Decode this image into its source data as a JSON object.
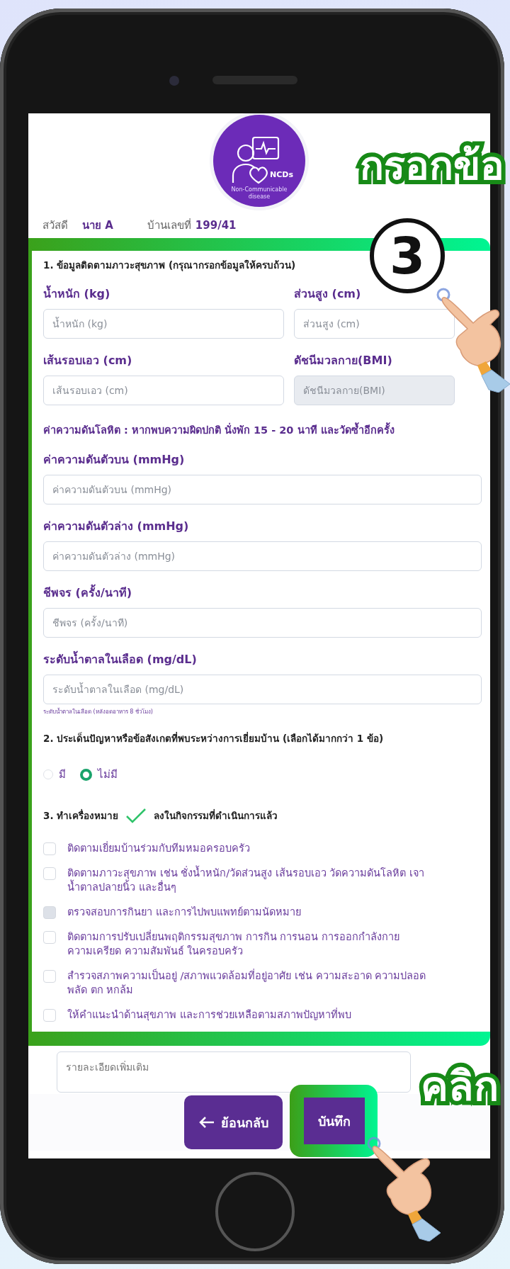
{
  "logo": {
    "title": "NCDs",
    "subtitle": "Non-Communicable disease"
  },
  "greeting": {
    "label": "สวัสดี",
    "name": "นาย A",
    "house_label": "บ้านเลขที่",
    "house_number": "199/41"
  },
  "section_1": {
    "title": "1. ข้อมูลติดตามภาวะสุขภาพ (กรุณากรอกข้อมูลให้ครบถ้วน)",
    "items": [
      {
        "kind": "pair",
        "fields": [
          {
            "label": "น้ำหนัก (kg)",
            "placeholder": "น้ำหนัก (kg)",
            "disabled": false
          },
          {
            "label": "ส่วนสูง (cm)",
            "placeholder": "ส่วนสูง (cm)",
            "disabled": false
          }
        ]
      },
      {
        "kind": "pair",
        "fields": [
          {
            "label": "เส้นรอบเอว (cm)",
            "placeholder": "เส้นรอบเอว (cm)",
            "disabled": false
          },
          {
            "label": "ดัชนีมวลกาย(BMI)",
            "placeholder": "ดัชนีมวลกาย(BMI)",
            "disabled": true
          }
        ]
      },
      {
        "kind": "note",
        "text": "ค่าความดันโลหิต : หากพบความผิดปกติ นั่งพัก 15 - 20 นาที และวัดซ้ำอีกครั้ง"
      },
      {
        "kind": "field",
        "label": "ค่าความดันตัวบน (mmHg)",
        "placeholder": "ค่าความดันตัวบน (mmHg)",
        "disabled": false
      },
      {
        "kind": "field",
        "label": "ค่าความดันตัวล่าง (mmHg)",
        "placeholder": "ค่าความดันตัวล่าง (mmHg)",
        "disabled": false
      },
      {
        "kind": "field",
        "label": "ชีพจร (ครั้ง/นาที)",
        "placeholder": "ชีพจร (ครั้ง/นาที)",
        "disabled": false
      },
      {
        "kind": "field",
        "label": "ระดับน้ำตาลในเลือด (mg/dL)",
        "placeholder": "ระดับน้ำตาลในเลือด (mg/dL)",
        "disabled": false
      },
      {
        "kind": "hint",
        "text": "ระดับน้ำตาลในเลือด (หลังอดอาหาร 8 ชั่วโมง)"
      }
    ]
  },
  "section_2": {
    "title": "2. ประเด็นปัญหาหรือข้อสังเกตที่พบระหว่างการเยี่ยมบ้าน (เลือกได้มากกว่า 1 ข้อ)",
    "options": [
      {
        "label": "มี",
        "selected": false
      },
      {
        "label": "ไม่มี",
        "selected": true
      }
    ]
  },
  "section_3": {
    "title_start": "3. ทำเครื่องหมาย",
    "title_end": "ลงในกิจกรรมที่ดำเนินการแล้ว",
    "items": [
      {
        "text": "ติดตามเยี่ยมบ้านร่วมกับทีมหมอครอบครัว",
        "checked": false,
        "disabled": false
      },
      {
        "text": "ติดตามภาวะสุขภาพ เช่น ชั่งน้ำหนัก/วัดส่วนสูง เส้นรอบเอว วัดความดันโลหิต เจา\nน้ำตาลปลายนิ้ว และอื่นๆ",
        "checked": false,
        "disabled": false
      },
      {
        "text": "ตรวจสอบการกินยา และการไปพบแพทย์ตามนัดหมาย",
        "checked": false,
        "disabled": true
      },
      {
        "text": "ติดตามการปรับเปลี่ยนพฤติกรรมสุขภาพ การกิน การนอน การออกกำลังกาย\nความเครียด ความสัมพันธ์ ในครอบครัว",
        "checked": false,
        "disabled": false
      },
      {
        "text": "สำรวจสภาพความเป็นอยู่ /สภาพแวดล้อมที่อยู่อาศัย เช่น ความสะอาด ความปลอด\nพลัด ตก หกล้ม",
        "checked": false,
        "disabled": false
      },
      {
        "text": "ให้คำแนะนำด้านสุขภาพ และการช่วยเหลือตามสภาพปัญหาที่พบ",
        "checked": false,
        "disabled": false
      }
    ]
  },
  "details": {
    "placeholder": "รายละเอียดเพิ่มเติม"
  },
  "buttons": {
    "back": "ย้อนกลับ",
    "save": "บันทึก"
  },
  "overlays": {
    "step_title": "กรอกข้อ",
    "step_number": "3",
    "click_label": "คลิก"
  }
}
